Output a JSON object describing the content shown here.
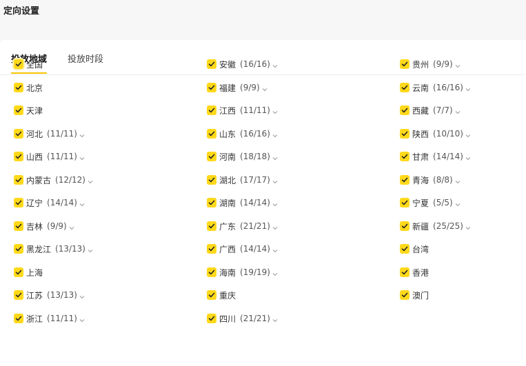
{
  "page": {
    "title": "定向设置"
  },
  "tabs": [
    {
      "label": "投放地域",
      "active": true
    },
    {
      "label": "投放时段",
      "active": false
    }
  ],
  "colors": {
    "accent": "#ffd91a",
    "underline": "#f5c400"
  },
  "columns": [
    [
      {
        "name": "全国",
        "count": ""
      },
      {
        "name": "北京",
        "count": ""
      },
      {
        "name": "天津",
        "count": ""
      },
      {
        "name": "河北",
        "count": "(11/11)"
      },
      {
        "name": "山西",
        "count": "(11/11)"
      },
      {
        "name": "内蒙古",
        "count": "(12/12)"
      },
      {
        "name": "辽宁",
        "count": "(14/14)"
      },
      {
        "name": "吉林",
        "count": "(9/9)"
      },
      {
        "name": "黑龙江",
        "count": "(13/13)"
      },
      {
        "name": "上海",
        "count": ""
      },
      {
        "name": "江苏",
        "count": "(13/13)"
      },
      {
        "name": "浙江",
        "count": "(11/11)"
      }
    ],
    [
      {
        "name": "安徽",
        "count": "(16/16)"
      },
      {
        "name": "福建",
        "count": "(9/9)"
      },
      {
        "name": "江西",
        "count": "(11/11)"
      },
      {
        "name": "山东",
        "count": "(16/16)"
      },
      {
        "name": "河南",
        "count": "(18/18)"
      },
      {
        "name": "湖北",
        "count": "(17/17)"
      },
      {
        "name": "湖南",
        "count": "(14/14)"
      },
      {
        "name": "广东",
        "count": "(21/21)"
      },
      {
        "name": "广西",
        "count": "(14/14)"
      },
      {
        "name": "海南",
        "count": "(19/19)"
      },
      {
        "name": "重庆",
        "count": ""
      },
      {
        "name": "四川",
        "count": "(21/21)"
      }
    ],
    [
      {
        "name": "贵州",
        "count": "(9/9)"
      },
      {
        "name": "云南",
        "count": "(16/16)"
      },
      {
        "name": "西藏",
        "count": "(7/7)"
      },
      {
        "name": "陕西",
        "count": "(10/10)"
      },
      {
        "name": "甘肃",
        "count": "(14/14)"
      },
      {
        "name": "青海",
        "count": "(8/8)"
      },
      {
        "name": "宁夏",
        "count": "(5/5)"
      },
      {
        "name": "新疆",
        "count": "(25/25)"
      },
      {
        "name": "台湾",
        "count": ""
      },
      {
        "name": "香港",
        "count": ""
      },
      {
        "name": "澳门",
        "count": ""
      }
    ]
  ]
}
